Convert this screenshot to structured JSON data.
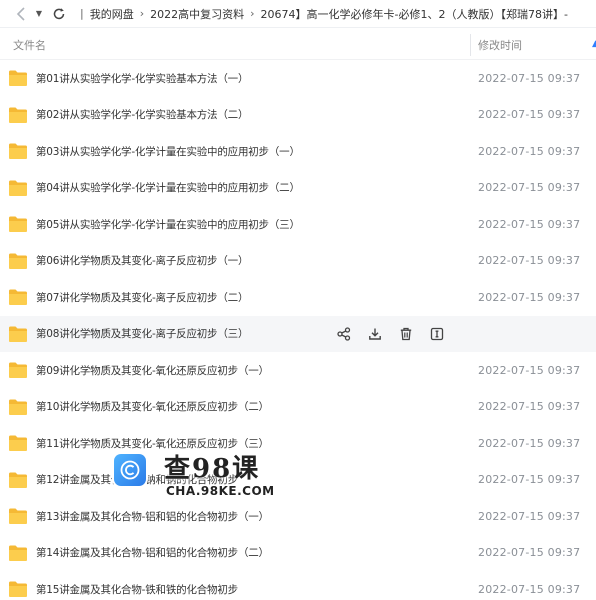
{
  "toolbar": {
    "breadcrumbs": [
      "我的网盘",
      "2022高中复习资料",
      "20674】高一化学必修年卡-必修1、2（人教版）【郑瑞78讲】-"
    ]
  },
  "header": {
    "name_col": "文件名",
    "time_col": "修改时间"
  },
  "files": [
    {
      "name": "第01讲从实验学化学-化学实验基本方法（一）",
      "time": "2022-07-15 09:37"
    },
    {
      "name": "第02讲从实验学化学-化学实验基本方法（二）",
      "time": "2022-07-15 09:37"
    },
    {
      "name": "第03讲从实验学化学-化学计量在实验中的应用初步（一）",
      "time": "2022-07-15 09:37"
    },
    {
      "name": "第04讲从实验学化学-化学计量在实验中的应用初步（二）",
      "time": "2022-07-15 09:37"
    },
    {
      "name": "第05讲从实验学化学-化学计量在实验中的应用初步（三）",
      "time": "2022-07-15 09:37"
    },
    {
      "name": "第06讲化学物质及其变化-离子反应初步（一）",
      "time": "2022-07-15 09:37"
    },
    {
      "name": "第07讲化学物质及其变化-离子反应初步（二）",
      "time": "2022-07-15 09:37"
    },
    {
      "name": "第08讲化学物质及其变化-离子反应初步（三）",
      "time": ""
    },
    {
      "name": "第09讲化学物质及其变化-氧化还原反应初步（一）",
      "time": "2022-07-15 09:37"
    },
    {
      "name": "第10讲化学物质及其变化-氧化还原反应初步（二）",
      "time": "2022-07-15 09:37"
    },
    {
      "name": "第11讲化学物质及其变化-氧化还原反应初步（三）",
      "time": "2022-07-15 09:37"
    },
    {
      "name": "第12讲金属及其化合物-钠和钠的化合物初步",
      "time": "2022-07-15 09:37"
    },
    {
      "name": "第13讲金属及其化合物-铝和铝的化合物初步（一）",
      "time": "2022-07-15 09:37"
    },
    {
      "name": "第14讲金属及其化合物-铝和铝的化合物初步（二）",
      "time": "2022-07-15 09:37"
    },
    {
      "name": "第15讲金属及其化合物-铁和铁的化合物初步",
      "time": "2022-07-15 09:37"
    }
  ],
  "hover_row_index": 7,
  "row_actions": [
    "share-icon",
    "download-icon",
    "delete-icon",
    "more-icon"
  ],
  "watermark": {
    "brand": "查98课",
    "url": "CHA.98KE.COM"
  },
  "colors": {
    "folder": "#f8c640",
    "accent": "#2f7fff",
    "time_text": "#8a8f96",
    "hover_bg": "#f5f6f8"
  }
}
